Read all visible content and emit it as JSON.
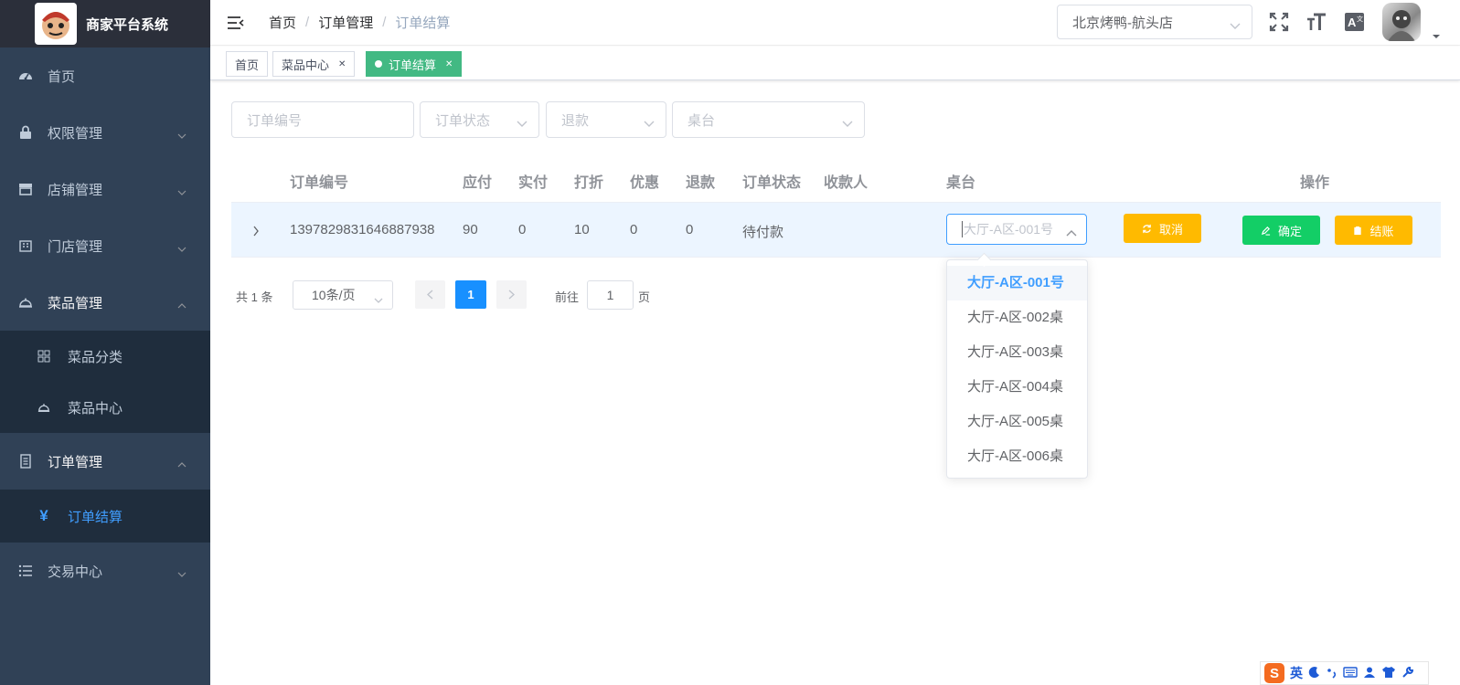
{
  "app": {
    "title": "商家平台系统"
  },
  "sidebar": {
    "items": [
      {
        "label": "首页",
        "icon": "dashboard-icon"
      },
      {
        "label": "权限管理",
        "icon": "lock-icon"
      },
      {
        "label": "店铺管理",
        "icon": "shop-icon"
      },
      {
        "label": "门店管理",
        "icon": "building-icon"
      },
      {
        "label": "菜品管理",
        "icon": "dish-cover-icon"
      },
      {
        "label": "订单管理",
        "icon": "document-icon"
      },
      {
        "label": "交易中心",
        "icon": "list-icon"
      }
    ],
    "dish_sub": [
      {
        "label": "菜品分类",
        "icon": "grid-icon"
      },
      {
        "label": "菜品中心",
        "icon": "dish-cover-icon"
      }
    ],
    "order_sub": [
      {
        "label": "订单结算",
        "icon": "yen-icon"
      }
    ]
  },
  "navbar": {
    "breadcrumb": [
      "首页",
      "订单管理",
      "订单结算"
    ],
    "shop_select": "北京烤鸭-航头店"
  },
  "tags": [
    {
      "label": "首页"
    },
    {
      "label": "菜品中心"
    },
    {
      "label": "订单结算"
    }
  ],
  "filters": {
    "order_no": "订单编号",
    "order_status": "订单状态",
    "refund": "退款",
    "table": "桌台"
  },
  "table": {
    "headers": [
      "订单编号",
      "应付",
      "实付",
      "打折",
      "优惠",
      "退款",
      "订单状态",
      "收款人",
      "桌台",
      "操作"
    ],
    "row": {
      "order_no": "1397829831646887938",
      "payable": "90",
      "paid": "0",
      "discount": "10",
      "coupon": "0",
      "refund": "0",
      "status": "待付款",
      "cashier": "",
      "table_placeholder": "大厅-A区-001号"
    },
    "actions": {
      "cancel": "取消",
      "confirm": "确定",
      "checkout": "结账"
    }
  },
  "dropdown": {
    "options": [
      "大厅-A区-001号",
      "大厅-A区-002桌",
      "大厅-A区-003桌",
      "大厅-A区-004桌",
      "大厅-A区-005桌",
      "大厅-A区-006桌"
    ],
    "selected_index": 0
  },
  "pagination": {
    "total": "共 1 条",
    "page_size": "10条/页",
    "current": "1",
    "goto_prefix": "前往",
    "goto_value": "1",
    "goto_suffix": "页"
  },
  "ime": {
    "label": "英"
  },
  "colors": {
    "sidebar_bg": "#304156",
    "submenu_bg": "#1f2d3d",
    "accent": "#409eff",
    "tag_active": "#42b983",
    "warning": "#ffba00",
    "success": "#13ce66"
  }
}
